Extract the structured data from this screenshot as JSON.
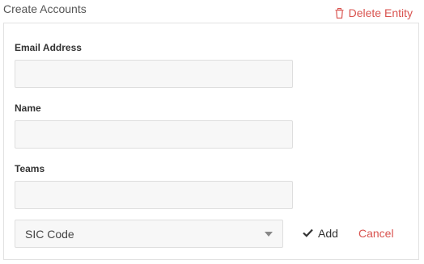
{
  "header": {
    "title": "Create Accounts",
    "delete_label": "Delete Entity"
  },
  "form": {
    "email": {
      "label": "Email Address",
      "value": "",
      "placeholder": ""
    },
    "name": {
      "label": "Name",
      "value": "",
      "placeholder": ""
    },
    "teams": {
      "label": "Teams",
      "value": "",
      "placeholder": ""
    },
    "sic": {
      "selected": "SIC Code"
    },
    "add_label": "Add",
    "cancel_label": "Cancel"
  },
  "colors": {
    "danger": "#d9534f",
    "input_bg": "#f7f7f7",
    "border": "#e2e2e2"
  },
  "icons": {
    "delete": "trash-icon",
    "add": "checkmark-icon",
    "select": "chevron-down-icon"
  }
}
